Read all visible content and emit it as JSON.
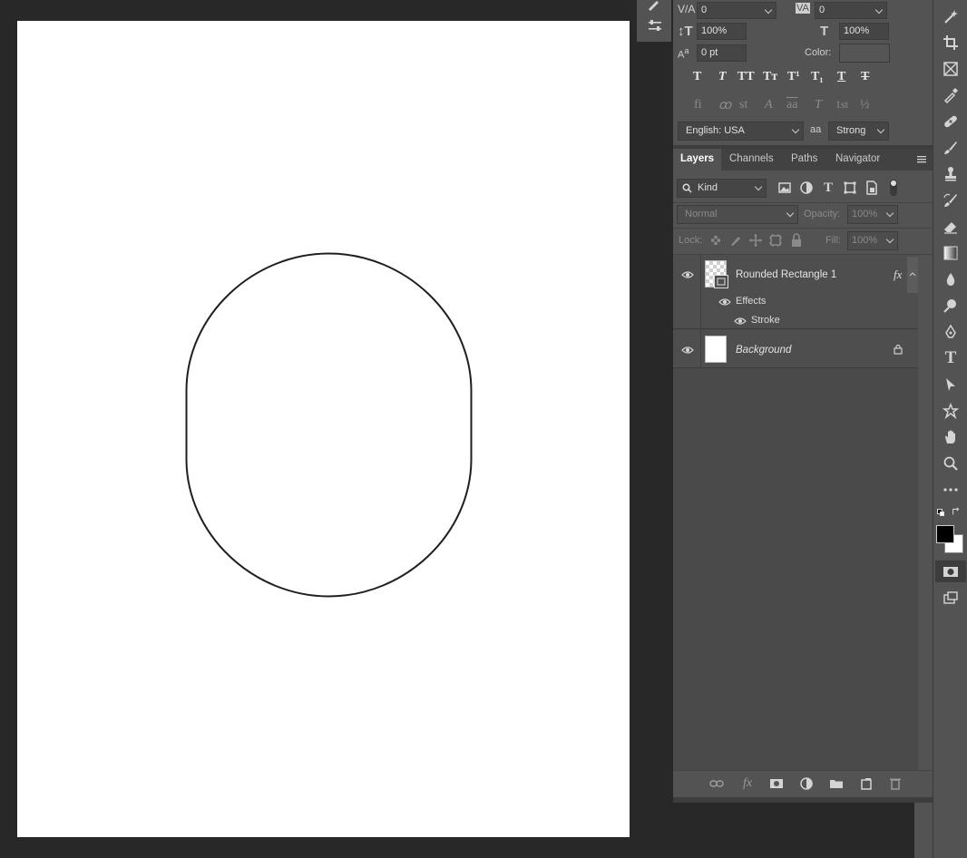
{
  "character": {
    "kerning_value": "0",
    "tracking_value": "0",
    "vscale_value": "100%",
    "hscale_value": "100%",
    "baseline_value": "0 pt",
    "color_label": "Color:",
    "language": "English: USA",
    "antialias_icon": "aa",
    "antialias": "Strong",
    "style_glyphs": [
      "T",
      "T",
      "TT",
      "Tт",
      "T¹",
      "T₁",
      "T",
      "T"
    ],
    "opentype_glyphs": [
      "fi",
      "ꝏ",
      "st",
      "A",
      "aa",
      "T",
      "1st",
      "½"
    ]
  },
  "layers_panel": {
    "tabs": [
      "Layers",
      "Channels",
      "Paths",
      "Navigator"
    ],
    "filter_label": "Kind",
    "blend_mode": "Normal",
    "opacity_label": "Opacity:",
    "opacity_value": "100%",
    "lock_label": "Lock:",
    "fill_label": "Fill:",
    "fill_value": "100%",
    "layers": [
      {
        "name": "Rounded Rectangle 1",
        "fx": "fx",
        "effects_label": "Effects",
        "stroke_label": "Stroke"
      },
      {
        "name": "Background"
      }
    ]
  },
  "colors": {
    "app_bg": "#282828",
    "panel_bg": "#535353",
    "canvas_bg": "#ffffff",
    "shape_stroke": "#1f1f1f",
    "foreground": "#000000",
    "background": "#ffffff"
  }
}
